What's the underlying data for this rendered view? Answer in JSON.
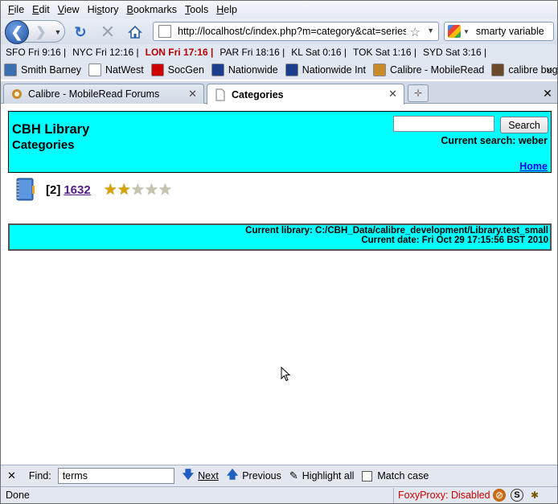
{
  "menu": [
    "File",
    "Edit",
    "View",
    "History",
    "Bookmarks",
    "Tools",
    "Help"
  ],
  "menu_access": [
    "F",
    "E",
    "V",
    "s",
    "B",
    "T",
    "H"
  ],
  "nav": {
    "url": "http://localhost/c/index.php?m=category&cat=series",
    "search_text": "smarty variable"
  },
  "clocks": [
    {
      "label": "SFO Fri 9:16 |",
      "highlight": false
    },
    {
      "label": "NYC Fri 12:16 |",
      "highlight": false
    },
    {
      "label": "LON Fri 17:16 |",
      "highlight": true
    },
    {
      "label": "PAR Fri 18:16 |",
      "highlight": false
    },
    {
      "label": "KL Sat 0:16 |",
      "highlight": false
    },
    {
      "label": "TOK Sat 1:16 |",
      "highlight": false
    },
    {
      "label": "SYD Sat 3:16 |",
      "highlight": false
    }
  ],
  "bookmarks": [
    {
      "label": "Smith Barney",
      "color": "#3a6fb0"
    },
    {
      "label": "NatWest",
      "color": "#ffffff"
    },
    {
      "label": "SocGen",
      "color": "#d00000"
    },
    {
      "label": "Nationwide",
      "color": "#1b3f8c"
    },
    {
      "label": "Nationwide Int",
      "color": "#1b3f8c"
    },
    {
      "label": "Calibre - MobileRead",
      "color": "#c98a2a"
    },
    {
      "label": "calibre bugs",
      "color": "#6a4a2a"
    }
  ],
  "bookmarks_more": "»",
  "tabs": [
    {
      "label": "Calibre - MobileRead Forums",
      "active": false
    },
    {
      "label": "Categories",
      "active": true
    }
  ],
  "page": {
    "title": "CBH Library",
    "subtitle": "Categories",
    "search_button": "Search",
    "current_search": "Current search: weber",
    "home_link": "Home",
    "item": {
      "count": "[2]",
      "name": "1632",
      "rating_stars": 2,
      "rating_max": 5
    },
    "footer_library": "Current library: C:/CBH_Data/calibre_development/Library.test_small",
    "footer_date": "Current date: Fri Oct 29 17:15:56 BST 2010"
  },
  "findbar": {
    "close": "✕",
    "label": "Find:",
    "value": "terms",
    "next": "Next",
    "previous": "Previous",
    "highlight": "Highlight all",
    "match_case": "Match case"
  },
  "status": {
    "text": "Done",
    "foxyproxy": "FoxyProxy: Disabled"
  },
  "colors": {
    "page_bg_accent": "#00ffff",
    "visited_link": "#551a8b",
    "link": "#0000ee"
  }
}
